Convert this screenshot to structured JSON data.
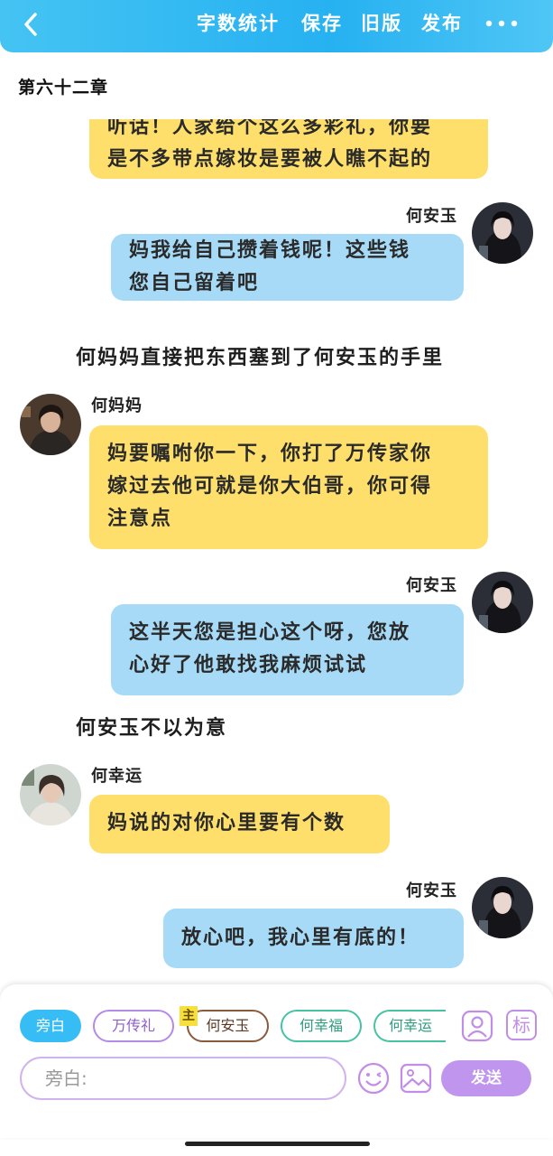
{
  "header": {
    "word_count": "字数统计",
    "save": "保存",
    "old_version": "旧版",
    "publish": "发布"
  },
  "chapter_title": "第六十二章",
  "messages": [
    {
      "type": "left",
      "text_lines": [
        "听话！人家给个这么多彩礼，你要",
        "是不多带点嫁妆是要被人瞧不起的"
      ]
    },
    {
      "type": "right",
      "sender": "何安玉",
      "text_lines": [
        "妈我给自己攒着钱呢！这些钱",
        "您自己留着吧"
      ]
    },
    {
      "type": "narration",
      "text": "何妈妈直接把东西塞到了何安玉的手里"
    },
    {
      "type": "left",
      "sender": "何妈妈",
      "text_lines": [
        "妈要嘱咐你一下，你打了万传家你",
        "嫁过去他可就是你大伯哥，你可得",
        "注意点"
      ]
    },
    {
      "type": "right",
      "sender": "何安玉",
      "text_lines": [
        "这半天您是担心这个呀，您放",
        "心好了他敢找我麻烦试试"
      ]
    },
    {
      "type": "narration",
      "text": "何安玉不以为意"
    },
    {
      "type": "left",
      "sender": "何幸运",
      "text_lines": [
        "妈说的对你心里要有个数"
      ]
    },
    {
      "type": "right",
      "sender": "何安玉",
      "text_lines": [
        "放心吧，我心里有底的！"
      ]
    }
  ],
  "composer": {
    "roles": [
      {
        "label": "旁白",
        "selected": true
      },
      {
        "label": "万传礼"
      },
      {
        "label": "何安玉",
        "badge": "主"
      },
      {
        "label": "何幸福"
      },
      {
        "label": "何幸运"
      }
    ],
    "input_placeholder": "旁白:",
    "send_label": "发送",
    "tag_icon_text": "标"
  },
  "colors": {
    "header": "#26b1f1",
    "left_bubble": "#fedf6c",
    "right_bubble": "#a6daf7",
    "send_button": "#bf95ee"
  }
}
